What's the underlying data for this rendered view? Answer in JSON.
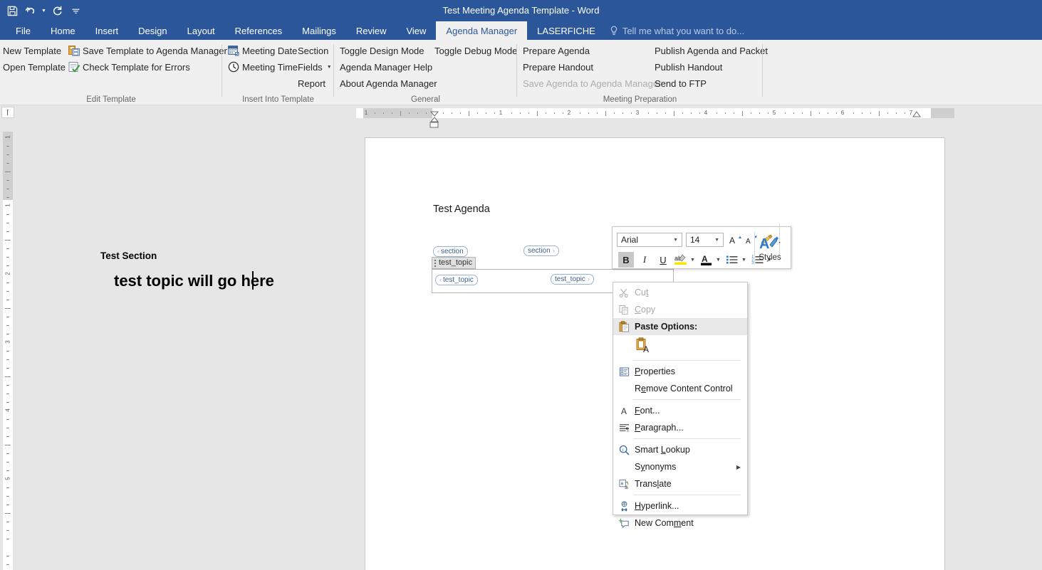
{
  "titlebar": {
    "document_title": "Test Meeting Agenda Template - Word",
    "quick_access": [
      {
        "name": "save-icon",
        "label": "Save"
      },
      {
        "name": "undo-icon",
        "label": "Undo"
      },
      {
        "name": "redo-icon",
        "label": "Redo"
      },
      {
        "name": "customize-qat-icon",
        "label": "Customize Quick Access Toolbar"
      }
    ]
  },
  "tabs": [
    {
      "label": "File",
      "active": false
    },
    {
      "label": "Home",
      "active": false
    },
    {
      "label": "Insert",
      "active": false
    },
    {
      "label": "Design",
      "active": false
    },
    {
      "label": "Layout",
      "active": false
    },
    {
      "label": "References",
      "active": false
    },
    {
      "label": "Mailings",
      "active": false
    },
    {
      "label": "Review",
      "active": false
    },
    {
      "label": "View",
      "active": false
    },
    {
      "label": "Agenda Manager",
      "active": true
    },
    {
      "label": "LASERFICHE",
      "active": false
    }
  ],
  "tell_me": "Tell me what you want to do...",
  "ribbon": {
    "groups": [
      {
        "title": "Edit Template",
        "items": [
          {
            "label": "New Template",
            "icon": null,
            "disabled": false
          },
          {
            "label": "Open Template",
            "icon": null,
            "disabled": false
          },
          {
            "label": "Save Template to Agenda Manager",
            "icon": "save-template-icon",
            "disabled": false
          },
          {
            "label": "Check Template for Errors",
            "icon": "check-template-icon",
            "disabled": false
          }
        ]
      },
      {
        "title": "Insert Into Template",
        "items": [
          {
            "label": "Meeting Date",
            "icon": "calendar-icon",
            "disabled": false
          },
          {
            "label": "Meeting Time",
            "icon": "clock-icon",
            "disabled": false
          },
          {
            "label": "Section",
            "icon": null,
            "disabled": false
          },
          {
            "label": "Fields",
            "icon": null,
            "disabled": false,
            "dropdown": true
          },
          {
            "label": "Report",
            "icon": null,
            "disabled": false
          }
        ]
      },
      {
        "title": "General",
        "items": [
          {
            "label": "Toggle Design Mode",
            "icon": null,
            "disabled": false
          },
          {
            "label": "Agenda Manager Help",
            "icon": null,
            "disabled": false
          },
          {
            "label": "About Agenda Manager",
            "icon": null,
            "disabled": false
          },
          {
            "label": "Toggle Debug Mode",
            "icon": null,
            "disabled": false
          }
        ]
      },
      {
        "title": "Meeting Preparation",
        "items": [
          {
            "label": "Prepare Agenda",
            "icon": null,
            "disabled": false
          },
          {
            "label": "Prepare Handout",
            "icon": null,
            "disabled": false
          },
          {
            "label": "Save Agenda to Agenda Manager",
            "icon": null,
            "disabled": true
          },
          {
            "label": "Publish Agenda and Packet",
            "icon": null,
            "disabled": false
          },
          {
            "label": "Publish Handout",
            "icon": null,
            "disabled": false
          },
          {
            "label": "Send to FTP",
            "icon": null,
            "disabled": false
          }
        ]
      }
    ]
  },
  "ruler": {
    "horizontal_numbers": [
      "1",
      "1",
      "2",
      "3",
      "4",
      "5",
      "6",
      "7"
    ],
    "vertical_numbers": [
      "1",
      "1",
      "2",
      "3",
      "4",
      "5"
    ],
    "unit": "inches"
  },
  "document": {
    "title_line": "Test Agenda",
    "section": {
      "tag_left": "section",
      "tag_right": "section",
      "text": "Test Section"
    },
    "topic": {
      "handle_label": "test_topic",
      "tag_left": "test_topic",
      "tag_right": "test_topic",
      "text": "test topic will go here"
    }
  },
  "mini_toolbar": {
    "font_family": "Arial",
    "font_size": "14",
    "buttons": [
      {
        "name": "grow-font-button",
        "label": "A"
      },
      {
        "name": "shrink-font-button",
        "label": "A"
      },
      {
        "name": "format-painter-button",
        "label": "Format Painter"
      },
      {
        "name": "bold-button",
        "label": "B",
        "active": true
      },
      {
        "name": "italic-button",
        "label": "I",
        "active": false
      },
      {
        "name": "underline-button",
        "label": "U",
        "active": false
      },
      {
        "name": "text-highlight-button",
        "label": "ab",
        "active": false
      },
      {
        "name": "font-color-button",
        "label": "A",
        "active": false
      },
      {
        "name": "bullets-button",
        "label": "Bullets",
        "active": false
      },
      {
        "name": "numbering-button",
        "label": "Numbering",
        "active": false
      }
    ],
    "styles_label": "Styles"
  },
  "context_menu": {
    "items": [
      {
        "label": "Cut",
        "icon": "scissors-icon",
        "disabled": true,
        "underline_index": 2
      },
      {
        "label": "Copy",
        "icon": "copy-icon",
        "disabled": true,
        "underline_index": 0
      },
      {
        "label": "Paste Options:",
        "icon": "paste-icon",
        "disabled": false,
        "header": true
      },
      {
        "label": "Keep Text Only",
        "icon": "paste-text-only-icon",
        "paste_option": true
      },
      {
        "label": "Properties",
        "icon": "properties-icon",
        "disabled": false,
        "underline_index": 0
      },
      {
        "label": "Remove Content Control",
        "icon": null,
        "disabled": false,
        "underline_index": 1
      },
      {
        "label": "Font...",
        "icon": "font-icon",
        "disabled": false,
        "underline_index": 0
      },
      {
        "label": "Paragraph...",
        "icon": "paragraph-icon",
        "disabled": false,
        "underline_index": 0
      },
      {
        "label": "Smart Lookup",
        "icon": "smart-lookup-icon",
        "disabled": false,
        "underline_index": 6
      },
      {
        "label": "Synonyms",
        "icon": null,
        "disabled": false,
        "submenu": true,
        "underline_index": 1
      },
      {
        "label": "Translate",
        "icon": "translate-icon",
        "disabled": false,
        "underline_index": 5
      },
      {
        "label": "Hyperlink...",
        "icon": "hyperlink-icon",
        "disabled": false,
        "underline_index": 0
      },
      {
        "label": "New Comment",
        "icon": "new-comment-icon",
        "disabled": false,
        "underline_index": 7
      }
    ]
  },
  "colors": {
    "word_blue": "#2b579a",
    "ribbon_bg": "#f0f0f0",
    "workspace_bg": "#e6e6e6",
    "page_bg": "#ffffff",
    "cc_tag_border": "#9ab4d4",
    "disabled_text": "#adadad"
  }
}
